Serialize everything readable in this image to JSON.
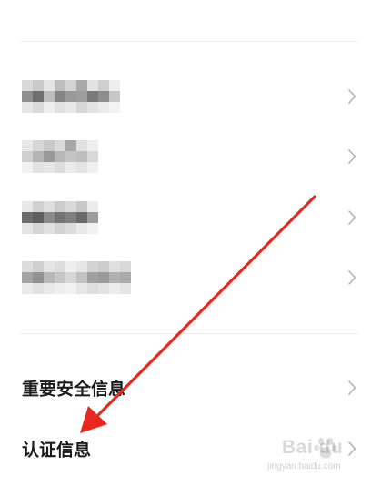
{
  "settings_list": {
    "blurred_items": [
      {
        "label": "",
        "blurred": true
      },
      {
        "label": "",
        "blurred": true
      },
      {
        "label": "",
        "blurred": true
      },
      {
        "label": "",
        "blurred": true
      }
    ],
    "items": [
      {
        "label": "重要安全信息"
      },
      {
        "label": "认证信息"
      }
    ]
  },
  "watermark": {
    "brand": "Bai du",
    "site": "jingyan.baidu.com"
  },
  "colors": {
    "annotation_arrow": "#e8281f",
    "chevron": "#b5b5b5",
    "divider": "#ececec"
  },
  "icons": {
    "row_chevron": "chevron-right-icon",
    "annotation": "red-arrow-annotation"
  }
}
